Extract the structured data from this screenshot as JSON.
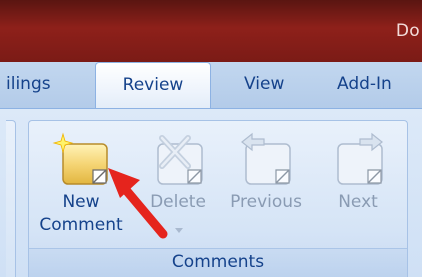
{
  "window": {
    "title": "Do"
  },
  "tabs": [
    {
      "label": "ilings"
    },
    {
      "label": "Review",
      "active": true
    },
    {
      "label": "View"
    },
    {
      "label": "Add-In"
    }
  ],
  "group": {
    "label": "Comments",
    "buttons": [
      {
        "label_line1": "New",
        "label_line2": "Comment",
        "icon": "new-comment-icon",
        "enabled": true
      },
      {
        "label_line1": "Delete",
        "icon": "delete-comment-icon",
        "enabled": false,
        "has_dropdown": true
      },
      {
        "label_line1": "Previous",
        "icon": "previous-comment-icon",
        "enabled": false
      },
      {
        "label_line1": "Next",
        "icon": "next-comment-icon",
        "enabled": false
      }
    ]
  },
  "annotation": {
    "type": "arrow",
    "color": "#e5241d",
    "points_to": "new-comment-button"
  }
}
